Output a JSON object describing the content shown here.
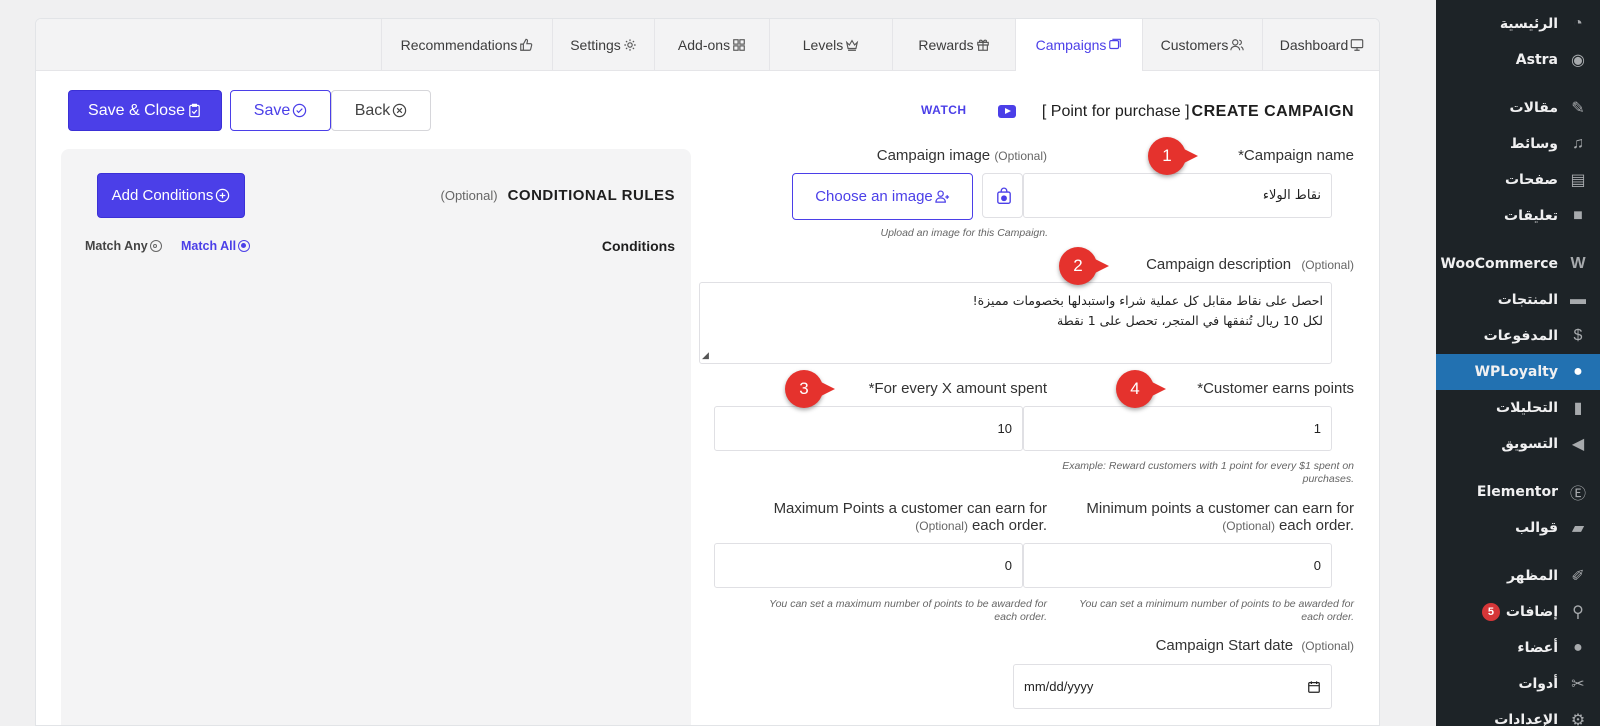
{
  "sidebar": {
    "items": [
      {
        "label": "الرئيسية",
        "icon": "dashboard-icon"
      },
      {
        "label": "Astra",
        "icon": "astra-icon"
      },
      {
        "label": "مقالات",
        "icon": "pin-icon"
      },
      {
        "label": "وسائط",
        "icon": "media-icon"
      },
      {
        "label": "صفحات",
        "icon": "pages-icon"
      },
      {
        "label": "تعليقات",
        "icon": "comments-icon"
      },
      {
        "label": "WooCommerce",
        "icon": "woocommerce-icon"
      },
      {
        "label": "المنتجات",
        "icon": "products-icon"
      },
      {
        "label": "المدفوعات",
        "icon": "payments-icon"
      },
      {
        "label": "WPLoyalty",
        "icon": "wployalty-icon"
      },
      {
        "label": "التحليلات",
        "icon": "analytics-icon"
      },
      {
        "label": "التسويق",
        "icon": "megaphone-icon"
      },
      {
        "label": "Elementor",
        "icon": "elementor-icon"
      },
      {
        "label": "قوالب",
        "icon": "folder-icon"
      },
      {
        "label": "المظهر",
        "icon": "brush-icon"
      },
      {
        "label": "إضافات",
        "icon": "plugin-icon",
        "badge": "5"
      },
      {
        "label": "أعضاء",
        "icon": "user-icon"
      },
      {
        "label": "أدوات",
        "icon": "wrench-icon"
      },
      {
        "label": "الإعدادات",
        "icon": "settings-icon"
      }
    ],
    "active_color": "#2271b1"
  },
  "tabs": {
    "dashboard": "Dashboard",
    "customers": "Customers",
    "campaigns": "Campaigns",
    "rewards": "Rewards",
    "levels": "Levels",
    "addons": "Add-ons",
    "settings": "Settings",
    "recommendations": "Recommendations"
  },
  "toolbar": {
    "save_close": "Save & Close",
    "save": "Save",
    "back": "Back"
  },
  "header": {
    "title": "CREATE CAMPAIGN",
    "campaign_name": "[ Point for purchase ]",
    "watch": "WATCH"
  },
  "conditions": {
    "title": "CONDITIONAL RULES",
    "optional": "(Optional)",
    "add_button": "Add Conditions",
    "label": "Conditions",
    "match_all": "Match All",
    "match_any": "Match Any"
  },
  "form": {
    "campaign_name": {
      "label": "*Campaign name",
      "value": "نقاط الولاء"
    },
    "campaign_image": {
      "label": "Campaign image",
      "optional": "(Optional)",
      "button": "Choose an image",
      "hint": "Upload an image for this Campaign."
    },
    "campaign_description": {
      "label": "Campaign description",
      "optional": "(Optional)",
      "line1": "احصل على نقاط مقابل كل عملية شراء واستبدلها بخصومات مميزة!",
      "line2": "لكل 10 ريال تُنفقها في المتجر، تحصل على 1 نقطة"
    },
    "customer_earns": {
      "label": "*Customer earns points",
      "value": "1",
      "hint_line1": "Example: Reward customers with 1 point for every $1 spent on",
      "hint_line2": "purchases."
    },
    "for_every": {
      "label": "*For every X amount spent",
      "value": "10"
    },
    "min_points": {
      "label_line1": "Minimum points a customer can earn for",
      "label_line2": "each order.",
      "optional": "(Optional)",
      "value": "0",
      "hint_line1": "You can set a minimum number of points to be awarded for",
      "hint_line2": "each order."
    },
    "max_points": {
      "label_line1": "Maximum Points a customer can earn for",
      "label_line2": "each order.",
      "optional": "(Optional)",
      "value": "0",
      "hint_line1": "You can set a maximum number of points to be awarded for",
      "hint_line2": "each order."
    },
    "start_date": {
      "label": "Campaign Start date",
      "optional": "(Optional)",
      "placeholder": "mm/dd/yyyy"
    }
  },
  "markers": [
    "1",
    "2",
    "3",
    "4"
  ],
  "colors": {
    "accent": "#4b3fe8",
    "marker": "#e5322d",
    "sidebar_bg": "#1d2327"
  }
}
